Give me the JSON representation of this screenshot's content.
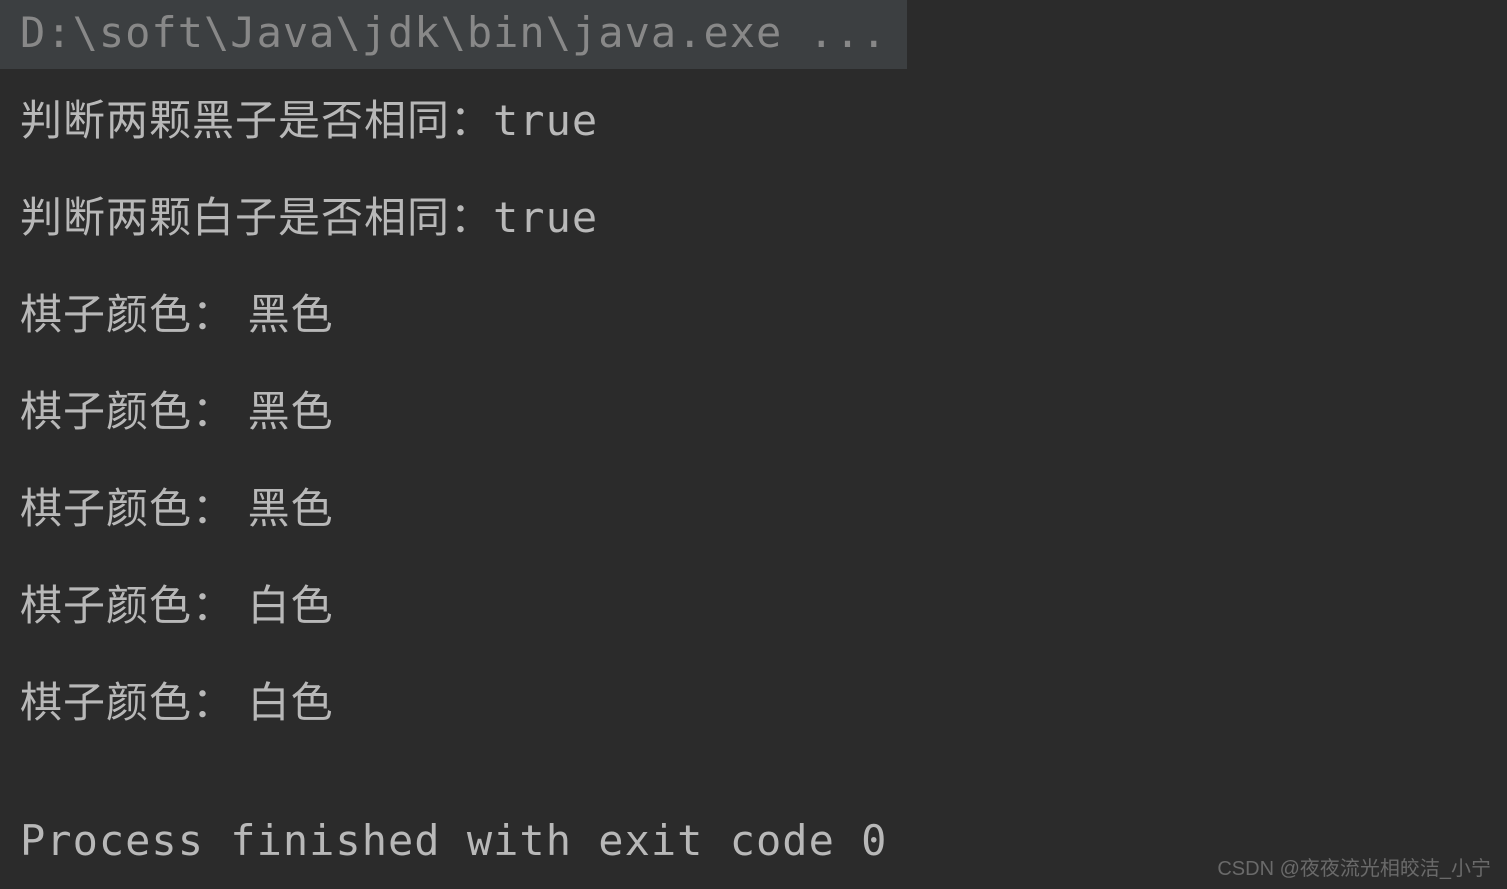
{
  "command": "D:\\soft\\Java\\jdk\\bin\\java.exe ...",
  "output": {
    "lines": [
      {
        "label": "判断两颗黑子是否相同：",
        "value": "true"
      },
      {
        "label": "判断两颗白子是否相同：",
        "value": "true"
      },
      {
        "label": "棋子颜色： ",
        "value": "黑色"
      },
      {
        "label": "棋子颜色： ",
        "value": "黑色"
      },
      {
        "label": "棋子颜色： ",
        "value": "黑色"
      },
      {
        "label": "棋子颜色： ",
        "value": "白色"
      },
      {
        "label": "棋子颜色： ",
        "value": "白色"
      }
    ]
  },
  "exitMessage": "Process finished with exit code 0",
  "watermark": "CSDN @夜夜流光相皎洁_小宁"
}
